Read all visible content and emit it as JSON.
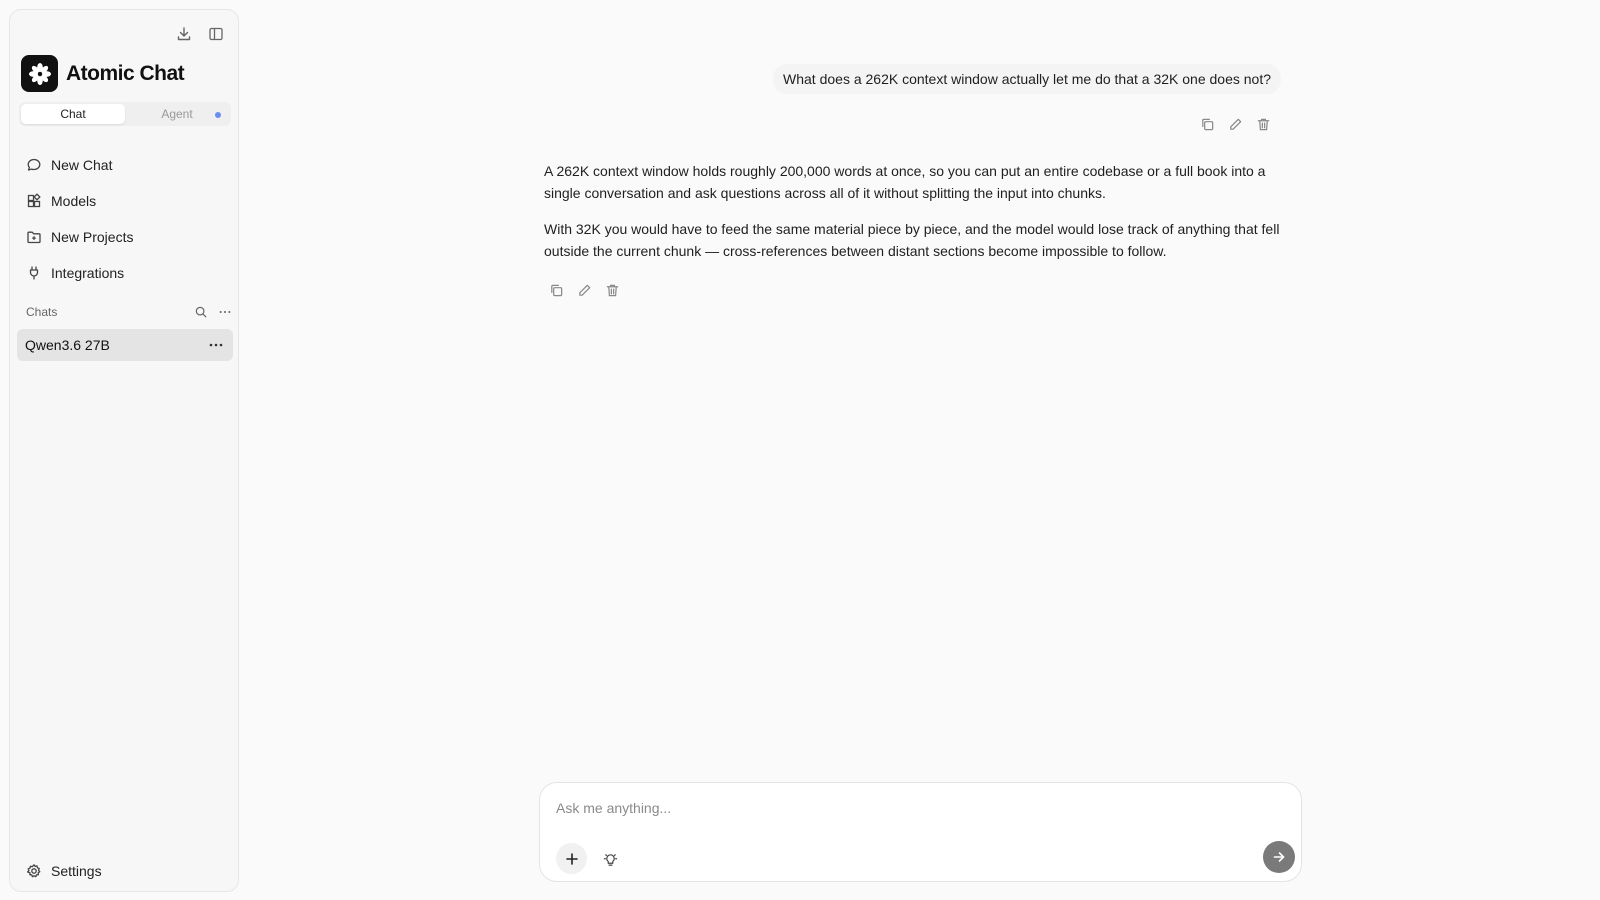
{
  "app": {
    "name": "Atomic Chat"
  },
  "sidebar": {
    "top_icons": [
      "download-icon",
      "sidebar-toggle-icon"
    ],
    "mode_tabs": [
      {
        "label": "Chat",
        "active": true
      },
      {
        "label": "Agent",
        "active": false
      }
    ],
    "nav": [
      {
        "label": "New Chat",
        "icon": "chat-bubble-icon"
      },
      {
        "label": "Models",
        "icon": "models-grid-icon"
      },
      {
        "label": "New Projects",
        "icon": "folder-plus-icon"
      },
      {
        "label": "Integrations",
        "icon": "plug-icon"
      }
    ],
    "chats_label": "Chats",
    "chats": [
      {
        "title": "Qwen3.6 27B",
        "selected": true
      }
    ],
    "settings_label": "Settings"
  },
  "conversation": {
    "user_message": "What does a 262K context window actually let me do that a 32K one does not?",
    "assistant_paragraphs": [
      "A 262K context window holds roughly 200,000 words at once, so you can put an entire codebase or a full book into a single conversation and ask questions across all of it without splitting the input into chunks.",
      "With 32K you would have to feed the same material piece by piece, and the model would lose track of anything that fell outside the current chunk — cross-references between distant sections become impossible to follow."
    ]
  },
  "composer": {
    "placeholder": "Ask me anything..."
  },
  "colors": {
    "agent_dot": "#6a8ef0",
    "send_button": "#7a7a7a",
    "selected_chat": "#e4e4e4"
  }
}
